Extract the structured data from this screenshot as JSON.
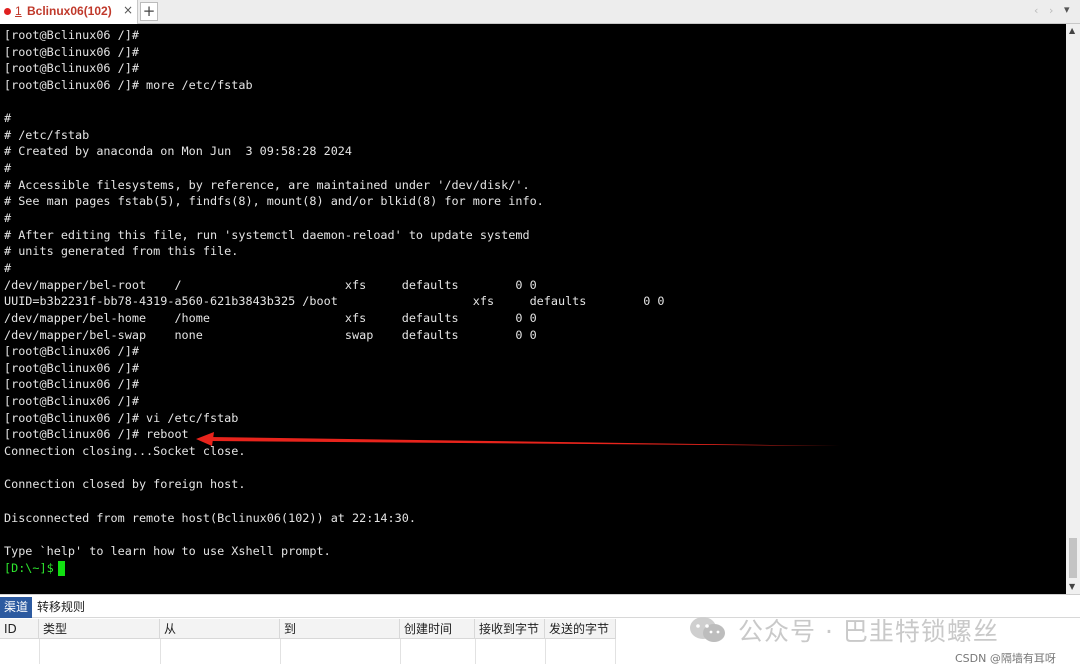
{
  "tabbar": {
    "tab_number": "1",
    "tab_title": "Bclinux06(102)",
    "close_symbol": "×",
    "add_symbol": "+",
    "nav_prev": "‹",
    "nav_next": "›",
    "menu_symbol": "▾"
  },
  "terminal": {
    "lines": [
      "[root@Bclinux06 /]#",
      "[root@Bclinux06 /]#",
      "[root@Bclinux06 /]#",
      "[root@Bclinux06 /]# more /etc/fstab",
      "",
      "#",
      "# /etc/fstab",
      "# Created by anaconda on Mon Jun  3 09:58:28 2024",
      "#",
      "# Accessible filesystems, by reference, are maintained under '/dev/disk/'.",
      "# See man pages fstab(5), findfs(8), mount(8) and/or blkid(8) for more info.",
      "#",
      "# After editing this file, run 'systemctl daemon-reload' to update systemd",
      "# units generated from this file.",
      "#",
      "/dev/mapper/bel-root    /                       xfs     defaults        0 0",
      "UUID=b3b2231f-bb78-4319-a560-621b3843b325 /boot                   xfs     defaults        0 0",
      "/dev/mapper/bel-home    /home                   xfs     defaults        0 0",
      "/dev/mapper/bel-swap    none                    swap    defaults        0 0",
      "[root@Bclinux06 /]#",
      "[root@Bclinux06 /]#",
      "[root@Bclinux06 /]#",
      "[root@Bclinux06 /]#",
      "[root@Bclinux06 /]# vi /etc/fstab",
      "[root@Bclinux06 /]# reboot",
      "Connection closing...Socket close.",
      "",
      "Connection closed by foreign host.",
      "",
      "Disconnected from remote host(Bclinux06(102)) at 22:14:30.",
      "",
      "Type `help' to learn how to use Xshell prompt."
    ],
    "local_prompt": "[D:\\~]$"
  },
  "bottom_panel": {
    "tabs": [
      "渠道",
      "转移规则"
    ],
    "columns": [
      "ID",
      "类型",
      "从",
      "到",
      "创建时间",
      "接收到字节",
      "发送的字节"
    ]
  },
  "watermark": {
    "text": "公众号 · 巴韭特锁螺丝"
  },
  "credit": "CSDN @隔墙有耳呀",
  "colors": {
    "terminal_bg": "#000000",
    "terminal_fg": "#e4e4e4",
    "prompt_green": "#2ee62e",
    "arrow_red": "#e8241c",
    "tab_title_red": "#c0392b",
    "active_tab_blue": "#2c5aa0"
  }
}
